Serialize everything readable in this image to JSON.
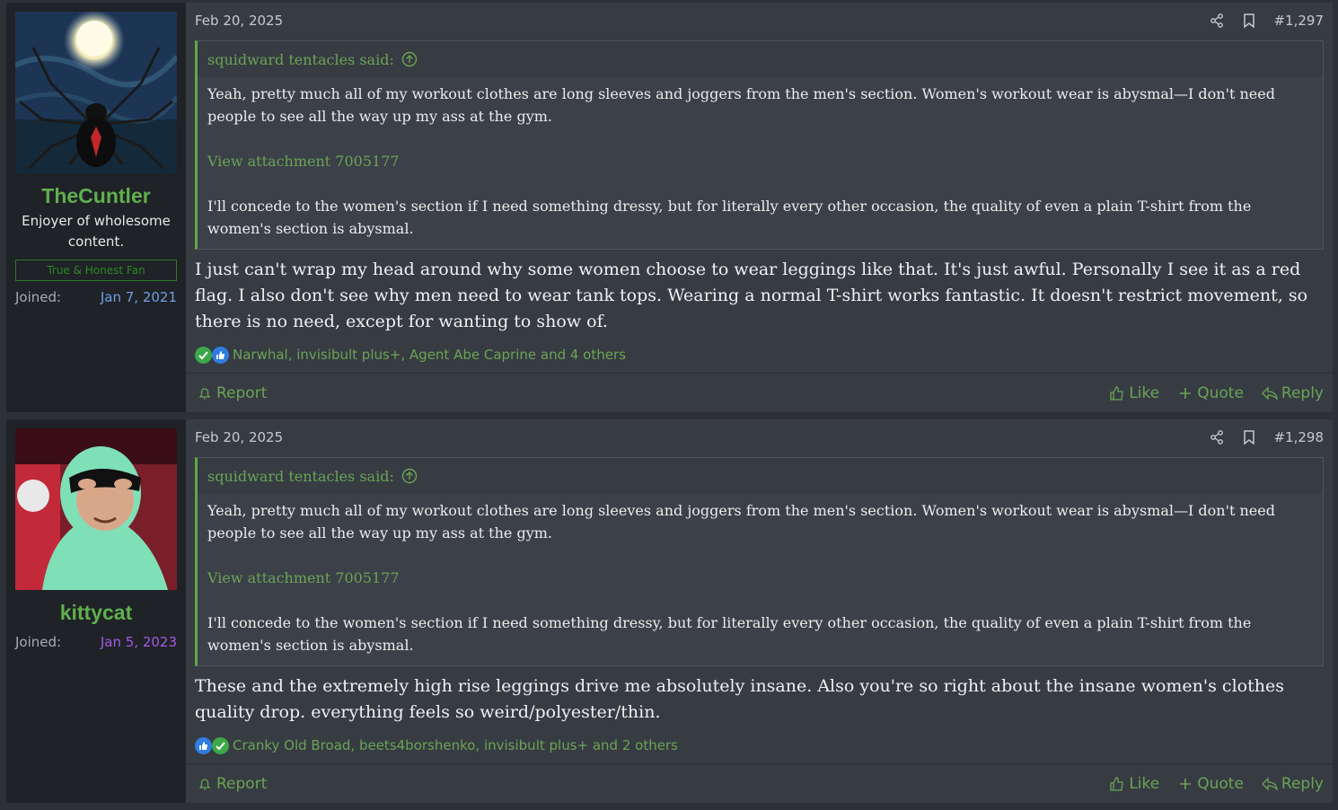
{
  "posts": [
    {
      "user": {
        "name": "TheCuntler",
        "title": "Enjoyer of wholesome content.",
        "banner": "True & Honest Fan",
        "joined_label": "Joined:",
        "joined_date": "Jan 7, 2021"
      },
      "date": "Feb 20, 2025",
      "number": "#1,297",
      "quote": {
        "author": "squidward tentacles said:",
        "p1": "Yeah, pretty much all of my workout clothes are long sleeves and joggers from the men's section. Women's workout wear is abysmal—I don't need people to see all the way up my ass at the gym.",
        "attachment": "View attachment 7005177",
        "p2": "I'll concede to the women's section if I need something dressy, but for literally every other occasion, the quality of even a plain T-shirt from the women's section is abysmal."
      },
      "text": "I just can't wrap my head around why some women choose to wear leggings like that. It's just awful. Personally I see it as a red flag. I also don't see why men need to wear tank tops. Wearing a normal T-shirt works fantastic. It doesn't restrict movement, so there is no need, except for wanting to show of.",
      "reactions": "Narwhal, invisibult plus+, Agent Abe Caprine and 4 others",
      "report": "Report",
      "like": "Like",
      "quote_btn": "Quote",
      "reply": "Reply"
    },
    {
      "user": {
        "name": "kittycat",
        "joined_label": "Joined:",
        "joined_date": "Jan 5, 2023"
      },
      "date": "Feb 20, 2025",
      "number": "#1,298",
      "quote": {
        "author": "squidward tentacles said:",
        "p1": "Yeah, pretty much all of my workout clothes are long sleeves and joggers from the men's section. Women's workout wear is abysmal—I don't need people to see all the way up my ass at the gym.",
        "attachment": "View attachment 7005177",
        "p2": "I'll concede to the women's section if I need something dressy, but for literally every other occasion, the quality of even a plain T-shirt from the women's section is abysmal."
      },
      "text": "These and the extremely high rise leggings drive me absolutely insane. Also you're so right about the insane women's clothes quality drop. everything feels so weird/polyester/thin.",
      "reactions": "Cranky Old Broad, beets4borshenko, invisibult plus+ and 2 others",
      "report": "Report",
      "like": "Like",
      "quote_btn": "Quote",
      "reply": "Reply"
    }
  ],
  "colors": {
    "accent": "#6aa456",
    "username": "#5fb04d",
    "background": "#2d3035",
    "post_bg": "#373b42"
  }
}
